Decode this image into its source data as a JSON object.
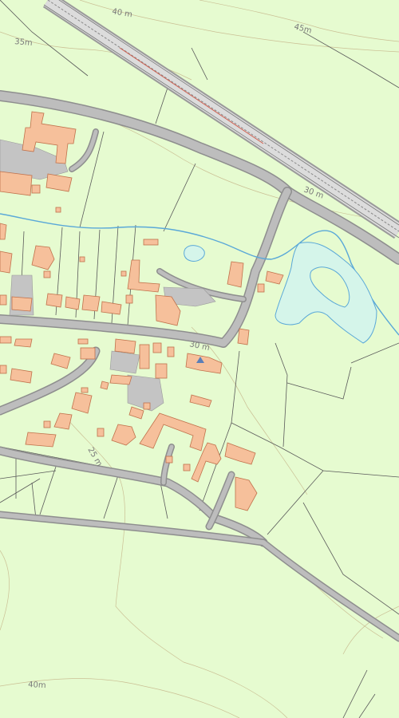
{
  "map": {
    "contour_labels": [
      {
        "text": "40 m"
      },
      {
        "text": "45m"
      },
      {
        "text": "35m"
      },
      {
        "text": "30 m"
      },
      {
        "text": "25 m"
      },
      {
        "text": "30 m"
      },
      {
        "text": "40m"
      }
    ],
    "colors": {
      "land": "#e6fbd0",
      "building": "#f6c09b",
      "road": "#bdbdbd",
      "water": "#d5f5ea",
      "stream": "#5aa8d8",
      "contour": "#c8b98e",
      "boundary": "#5a5a5a"
    },
    "icons": [
      "church-triangle-icon"
    ]
  }
}
